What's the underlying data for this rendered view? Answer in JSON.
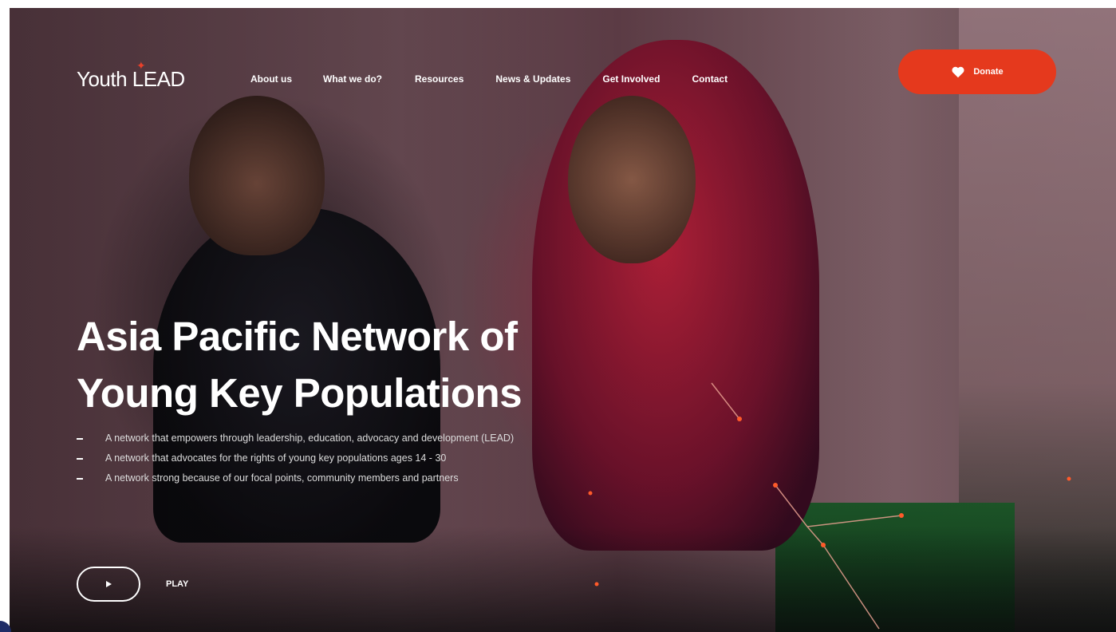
{
  "brand": {
    "logo_text": "Youth LEAD",
    "accent_color": "#e5391d"
  },
  "nav": {
    "items": [
      {
        "label": "About us"
      },
      {
        "label": "What we do?"
      },
      {
        "label": "Resources"
      },
      {
        "label": "News & Updates"
      },
      {
        "label": "Get Involved"
      },
      {
        "label": "Contact"
      }
    ]
  },
  "donate": {
    "label": "Donate",
    "icon": "heart-icon"
  },
  "hero": {
    "title_line1": "Asia Pacific Network of",
    "title_line2": "Young Key Populations",
    "bullets": [
      {
        "text": "A network that empowers through leadership, education, advocacy and development (LEAD)"
      },
      {
        "text": "A network that advocates for the rights of young key populations ages 14 - 30"
      },
      {
        "text": "A network strong because of our focal points, community members and partners"
      }
    ]
  },
  "media": {
    "play_label": "PLAY",
    "play_icon": "play-icon"
  }
}
